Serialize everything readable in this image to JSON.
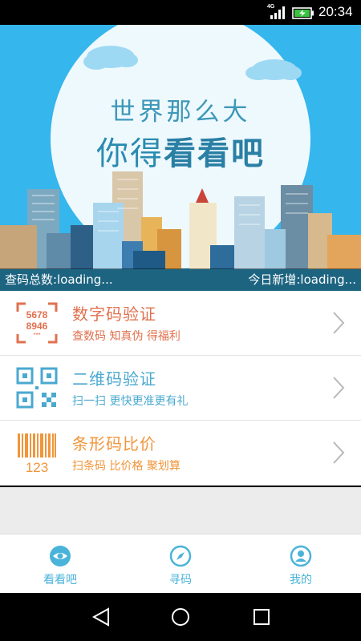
{
  "status_bar": {
    "network": "4G",
    "time": "20:34",
    "icons": [
      "signal-icon",
      "battery-charging-icon"
    ]
  },
  "banner": {
    "title_line1": "世界那么大",
    "title_line2_normal": "你得",
    "title_line2_bold": "看看吧",
    "total_count": "查码总数:loading...",
    "today_new": "今日新增:loading..."
  },
  "menu": {
    "items": [
      {
        "title": "数字码验证",
        "subtitle": "查数码 知真伪 得福利",
        "color": "#e0714f",
        "icon": "digital-code-icon",
        "icon_text_line1": "5678",
        "icon_text_line2": "8946",
        "icon_text_line3": "***"
      },
      {
        "title": "二维码验证",
        "subtitle": "扫一扫 更快更准更有礼",
        "color": "#4aa9cf",
        "icon": "qr-code-icon"
      },
      {
        "title": "条形码比价",
        "subtitle": "扫条码 比价格 聚划算",
        "color": "#f0953a",
        "icon": "barcode-icon",
        "icon_text": "123"
      }
    ]
  },
  "tabs": [
    {
      "label": "看看吧",
      "icon": "eye-icon"
    },
    {
      "label": "寻码",
      "icon": "compass-icon"
    },
    {
      "label": "我的",
      "icon": "user-icon"
    }
  ],
  "nav": {
    "icons": [
      "back-icon",
      "home-icon",
      "recents-icon"
    ]
  },
  "colors": {
    "accent": "#4ab3d9",
    "banner_sky": "#35b6ec"
  }
}
